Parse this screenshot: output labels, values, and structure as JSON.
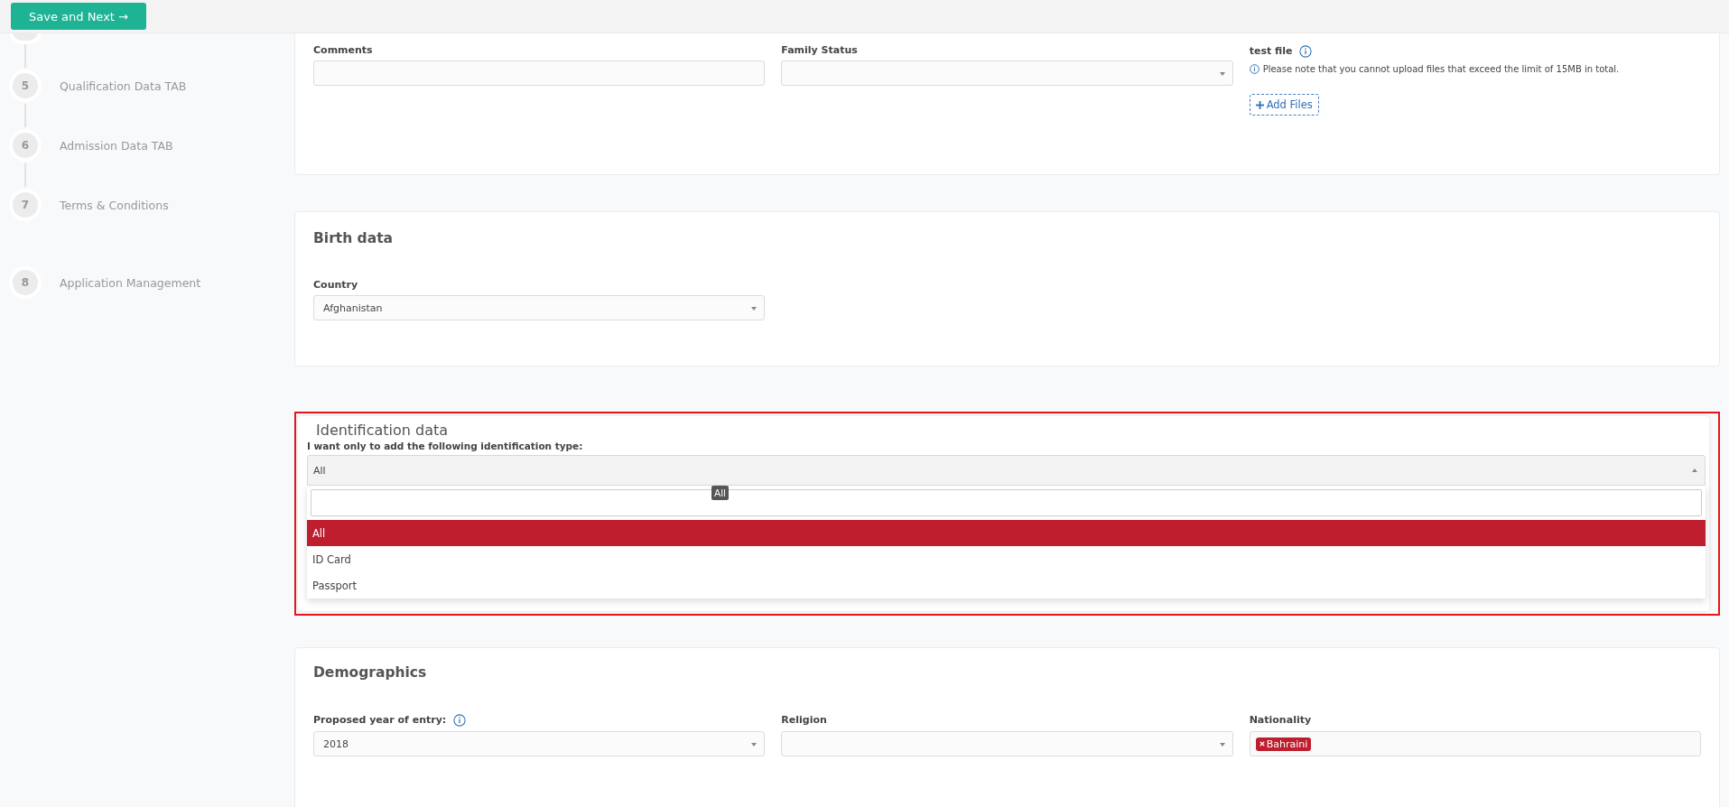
{
  "header": {
    "save_button": "Save and Next →"
  },
  "steps": [
    {
      "number": "5",
      "label": "Qualification Data TAB"
    },
    {
      "number": "6",
      "label": "Admission Data TAB"
    },
    {
      "number": "7",
      "label": "Terms & Conditions"
    },
    {
      "number": "8",
      "label": "Application Management"
    }
  ],
  "general": {
    "fields": [
      {
        "kind": "text",
        "label": "Comments"
      },
      {
        "kind": "select",
        "label": "Family Status"
      }
    ],
    "upload": {
      "label": "test file",
      "note": "Please note that you cannot upload files that exceed the limit of 15MB in total.",
      "button": "Add Files"
    }
  },
  "birth_data": {
    "title": "Birth data",
    "fields": [
      {
        "kind": "select",
        "label": "Country",
        "value": "Afghanistan"
      }
    ]
  },
  "identification": {
    "title": "Identification data",
    "highlighted": true,
    "prompt": "I want only to add the following identification type:",
    "value": "All",
    "tooltip": "All",
    "options": [
      {
        "label": "All",
        "selected": true
      },
      {
        "label": "ID Card",
        "selected": false
      },
      {
        "label": "Passport",
        "selected": false
      }
    ]
  },
  "demographics": {
    "title": "Demographics",
    "fields": [
      {
        "kind": "select",
        "label": "Proposed year of entry:",
        "info": true,
        "value": "2018"
      },
      {
        "kind": "select",
        "label": "Religion"
      },
      {
        "kind": "tags",
        "label": "Nationality",
        "tags": [
          "Bahraini"
        ]
      }
    ]
  }
}
